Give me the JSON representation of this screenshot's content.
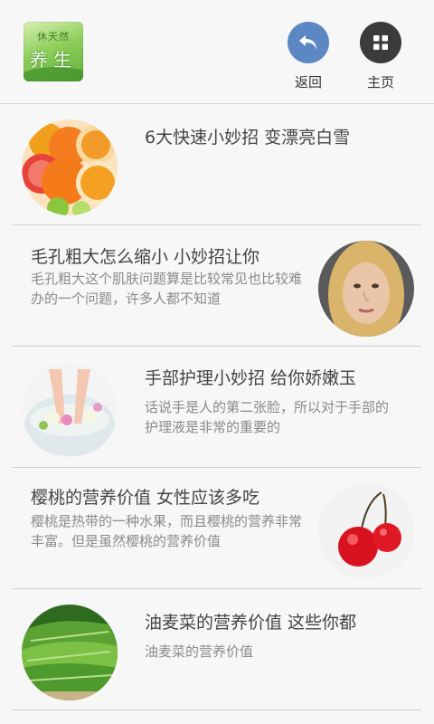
{
  "header": {
    "logo_text_top": "休天然",
    "logo_text_main": "养生",
    "back_label": "返回",
    "home_label": "主页",
    "back_icon": "back-arrow-icon",
    "home_icon": "grid-icon",
    "colors": {
      "back": "#5b87c2",
      "home": "#3b3b3b"
    }
  },
  "items": [
    {
      "title": "6大快速小妙招 变漂亮白雪",
      "desc": "",
      "image": "citrus-fruits"
    },
    {
      "title": "毛孔粗大怎么缩小 小妙招让你",
      "desc": "毛孔粗大这个肌肤问题算是比较常见也比较难办的一个问题，许多人都不知道",
      "image": "woman-face"
    },
    {
      "title": "手部护理小妙招 给你娇嫩玉",
      "desc": "话说手是人的第二张脸，所以对于手部的护理液是非常的重要的",
      "image": "hands-in-bowl"
    },
    {
      "title": "樱桃的营养价值 女性应该多吃",
      "desc": "樱桃是热带的一种水果，而且樱桃的营养非常丰富。但是虽然樱桃的营养价值",
      "image": "cherries"
    },
    {
      "title": "油麦菜的营养价值 这些你都",
      "desc": "油麦菜的营养价值",
      "image": "lettuce"
    }
  ]
}
